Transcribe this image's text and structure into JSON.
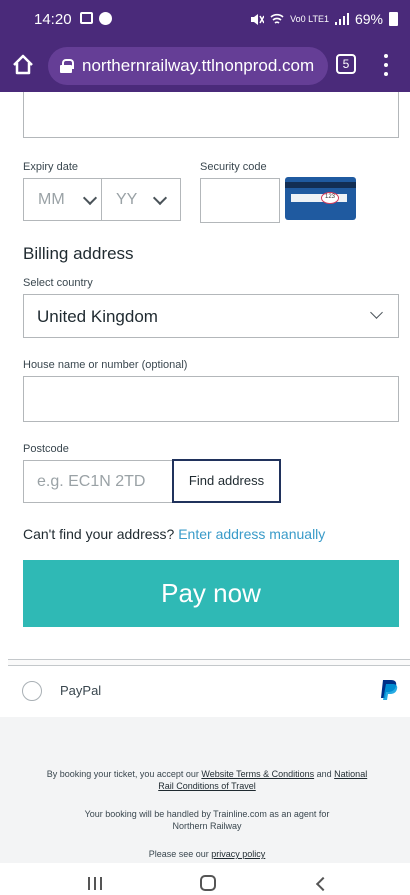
{
  "status_bar": {
    "time": "14:20",
    "network": "Vo0 LTE1",
    "battery": "69%"
  },
  "browser": {
    "url": "northernrailway.ttlnonprod.com",
    "tab_count": "5"
  },
  "form": {
    "expiry": {
      "label": "Expiry date",
      "month_placeholder": "MM",
      "year_placeholder": "YY"
    },
    "security_code": {
      "label": "Security code",
      "card_hint": "123"
    },
    "billing": {
      "title": "Billing address",
      "country_label": "Select country",
      "country_value": "United Kingdom",
      "house_label": "House name or number (optional)",
      "postcode_label": "Postcode",
      "postcode_placeholder": "e.g. EC1N 2TD",
      "find_address_label": "Find address",
      "cant_find_text": "Can't find your address?",
      "enter_manually_link": "Enter address manually"
    },
    "pay_button": "Pay now"
  },
  "payment_methods": {
    "paypal_label": "PayPal"
  },
  "footer": {
    "terms_prefix": "By booking your ticket, you accept our",
    "website_terms_link": "Website Terms & Conditions",
    "and_text": "and",
    "national_rail_link_1": "National",
    "national_rail_link_2": "Rail Conditions of Travel",
    "agent_line_1": "Your booking will be handled by Trainline.com as an agent for",
    "agent_line_2": "Northern Railway",
    "privacy_prefix": "Please see our",
    "privacy_link": "privacy policy"
  },
  "colors": {
    "browser_bar": "#4a2a7a",
    "pay_button": "#2fb9b5",
    "link": "#3a9bc9",
    "find_button_border": "#20325c",
    "paypal_blue": "#003087"
  }
}
